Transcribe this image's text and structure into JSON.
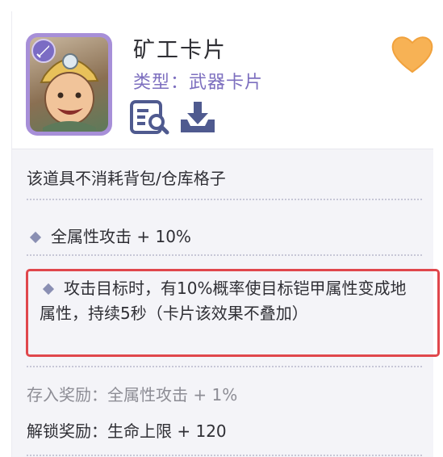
{
  "card": {
    "title": "矿工卡片",
    "type_label": "类型：武器卡片",
    "accent_color": "#7d6fbf",
    "heart_color": "#f7b255",
    "highlight_color": "#e0474c"
  },
  "icons": {
    "portrait": "miner-portrait-icon",
    "inspect": "inspect-magnifier-icon",
    "download": "download-tray-icon",
    "favorite": "heart-icon"
  },
  "body": {
    "note": "该道具不消耗背包/仓库格子",
    "stat_line": "全属性攻击 + 10%",
    "effect": "攻击目标时，有10%概率使目标铠甲属性变成地属性，持续5秒（卡片该效果不叠加）",
    "deposit_reward": "存入奖励：全属性攻击 + 1%",
    "unlock_reward": "解锁奖励：生命上限 + 120"
  }
}
